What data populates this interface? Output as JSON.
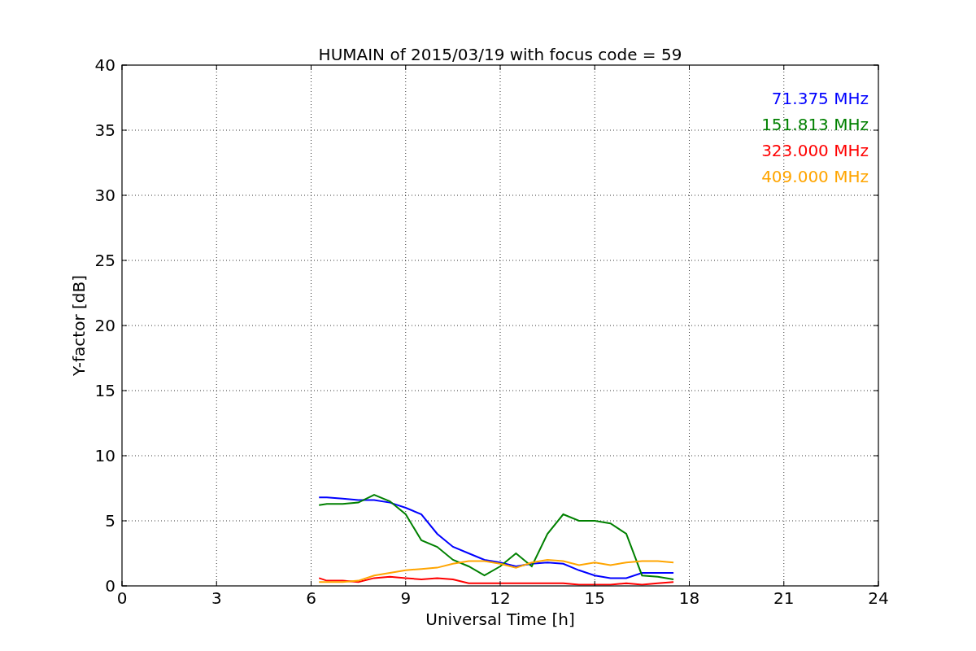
{
  "chart_data": {
    "type": "line",
    "title": "HUMAIN of 2015/03/19 with focus code = 59",
    "xlabel": "Universal Time [h]",
    "ylabel": "Y-factor [dB]",
    "x": [
      6.25,
      6.5,
      7,
      7.5,
      8,
      8.5,
      9,
      9.5,
      10,
      10.5,
      11,
      11.5,
      12,
      12.5,
      13,
      13.5,
      14,
      14.5,
      15,
      15.5,
      16,
      16.5,
      17,
      17.5
    ],
    "series": [
      {
        "name": "71.375 MHz",
        "color": "#0000ff",
        "values": [
          6.8,
          6.8,
          6.7,
          6.6,
          6.6,
          6.4,
          6.0,
          5.5,
          4.0,
          3.0,
          2.5,
          2.0,
          1.8,
          1.5,
          1.7,
          1.8,
          1.7,
          1.2,
          0.8,
          0.6,
          0.6,
          1.0,
          1.0,
          1.0
        ]
      },
      {
        "name": "151.813 MHz",
        "color": "#008000",
        "values": [
          6.2,
          6.3,
          6.3,
          6.4,
          7.0,
          6.5,
          5.5,
          3.5,
          3.0,
          2.0,
          1.5,
          0.8,
          1.5,
          2.5,
          1.5,
          4.0,
          5.5,
          5.0,
          5.0,
          4.8,
          4.0,
          0.8,
          0.7,
          0.5
        ]
      },
      {
        "name": "323.000 MHz",
        "color": "#ff0000",
        "values": [
          0.6,
          0.4,
          0.4,
          0.3,
          0.6,
          0.7,
          0.6,
          0.5,
          0.6,
          0.5,
          0.2,
          0.2,
          0.2,
          0.2,
          0.2,
          0.2,
          0.2,
          0.1,
          0.1,
          0.1,
          0.2,
          0.1,
          0.2,
          0.3
        ]
      },
      {
        "name": "409.000 MHz",
        "color": "#ffa500",
        "values": [
          0.3,
          0.3,
          0.3,
          0.4,
          0.8,
          1.0,
          1.2,
          1.3,
          1.4,
          1.7,
          1.9,
          1.9,
          1.7,
          1.4,
          1.8,
          2.0,
          1.9,
          1.6,
          1.8,
          1.6,
          1.8,
          1.9,
          1.9,
          1.8
        ]
      }
    ],
    "grid": true,
    "xlim": [
      0,
      24
    ],
    "ylim": [
      0,
      40
    ],
    "xticks": [
      0,
      3,
      6,
      9,
      12,
      15,
      18,
      21,
      24
    ],
    "yticks": [
      0,
      5,
      10,
      15,
      20,
      25,
      30,
      35,
      40
    ]
  }
}
